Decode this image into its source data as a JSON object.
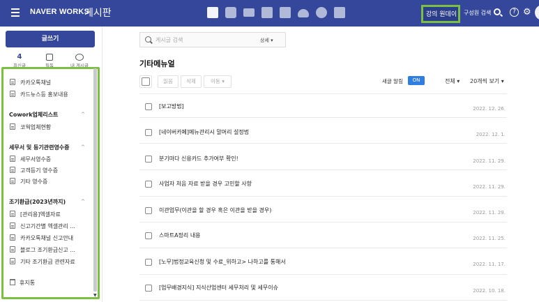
{
  "header": {
    "brand": "NAVER WORKS",
    "app_name": "게시판",
    "highlight_label": "강의 원데이",
    "member_search_label": "구성원 검색",
    "icons": [
      "document-icon",
      "chat-icon",
      "mail-icon",
      "calendar-icon",
      "contact-icon",
      "cloud-icon",
      "check-icon",
      "table-icon"
    ],
    "highlight_color": "#7bc043",
    "bar_color": "#34479a"
  },
  "sidebar": {
    "write_label": "글쓰기",
    "quick_links": [
      {
        "count": "4",
        "label": "최신글"
      },
      {
        "label": "필독"
      },
      {
        "label": "내 게시글"
      }
    ],
    "items_top": [
      "카카오톡채널",
      "카드뉴스등 홍보내용"
    ],
    "groups": [
      {
        "name": "Cowork업체리스트",
        "items": [
          "코웍업체현황"
        ]
      },
      {
        "name": "세무서 및 등기관련영수증",
        "items": [
          "세무서영수증",
          "고객등기 영수증",
          "기타 영수증"
        ]
      },
      {
        "name": "조기환급(2023년까지)",
        "items": [
          "[관리용]엑셀자료",
          "신고기간별 엑셀관리 ...",
          "카카오톡채널 신고안내",
          "블로그 조기환급신고 ...",
          "기타 조기환급 관련자료"
        ]
      }
    ],
    "trash_label": "휴지통"
  },
  "main": {
    "search_placeholder": "게시글 검색",
    "search_detail": "상세 ▾",
    "title": "기타메뉴얼",
    "toolbar": {
      "read": "읽음",
      "delete": "삭제",
      "move": "이동 ▾"
    },
    "notify_label": "새글 알림",
    "notify_state": "ON",
    "filter_all": "전체 ▾",
    "page_size": "20개씩 보기 ▾",
    "posts": [
      {
        "title": "[보고방법]",
        "date": "2022. 12. 26."
      },
      {
        "title": "[네이버카페]메뉴관리시 말머리 설정법",
        "date": "2022. 12. 1."
      },
      {
        "title": "분기마다 신용카드 추가여부 확인!",
        "date": "2022. 11. 29."
      },
      {
        "title": "사업자 처음 자료 받을 경우 고민할 사항",
        "date": "2022. 11. 29."
      },
      {
        "title": "이관업무(이관을 할 경우 혹은 이관을 받을 경우)",
        "date": "2022. 11. 29."
      },
      {
        "title": "스마트A정리 내용",
        "date": "2022. 11. 25."
      },
      {
        "title": "[노무]법정교육신청 및 수료_위하고> 나하고를 통해서",
        "date": "2022. 11. 17."
      },
      {
        "title": "[업무배경지식] 지식산업센터 세무처리 및 세무이슈",
        "date": "2022. 10. 18."
      }
    ]
  }
}
